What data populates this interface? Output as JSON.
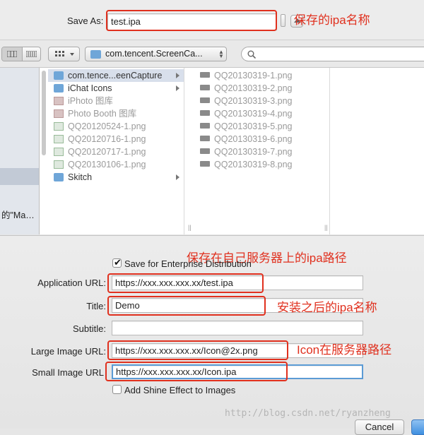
{
  "save_as": {
    "label": "Save As:",
    "value": "test.ipa"
  },
  "annotations": {
    "ipa_name": "保存的ipa名称",
    "server_path": "保存在自己服务器上的ipa路径",
    "post_install_name": "安装之后的ipa名称",
    "icon_path": "Icon在服务器路径"
  },
  "toolbar": {
    "location": "com.tencent.ScreenCa..."
  },
  "sidebar": {
    "truncated_text": "的\"Ma…"
  },
  "column1": [
    {
      "name": "com.tence...eenCapture",
      "icon": "folder-icon",
      "selected": true,
      "has_child": true,
      "dim": false
    },
    {
      "name": "iChat Icons",
      "icon": "folder-icon",
      "selected": false,
      "has_child": true,
      "dim": false
    },
    {
      "name": "iPhoto 图库",
      "icon": "photo-library-icon",
      "selected": false,
      "has_child": false,
      "dim": true
    },
    {
      "name": "Photo Booth 图库",
      "icon": "photo-library-icon",
      "selected": false,
      "has_child": false,
      "dim": true
    },
    {
      "name": "QQ20120524-1.png",
      "icon": "image-file-icon",
      "selected": false,
      "has_child": false,
      "dim": true
    },
    {
      "name": "QQ20120716-1.png",
      "icon": "image-file-icon",
      "selected": false,
      "has_child": false,
      "dim": true
    },
    {
      "name": "QQ20120717-1.png",
      "icon": "image-file-icon",
      "selected": false,
      "has_child": false,
      "dim": true
    },
    {
      "name": "QQ20130106-1.png",
      "icon": "image-file-icon",
      "selected": false,
      "has_child": false,
      "dim": true
    },
    {
      "name": "Skitch",
      "icon": "folder-icon",
      "selected": false,
      "has_child": true,
      "dim": false
    }
  ],
  "column2": [
    "QQ20130319-1.png",
    "QQ20130319-2.png",
    "QQ20130319-3.png",
    "QQ20130319-4.png",
    "QQ20130319-5.png",
    "QQ20130319-6.png",
    "QQ20130319-7.png",
    "QQ20130319-8.png"
  ],
  "options": {
    "save_enterprise": "Save for Enterprise Distribution",
    "save_enterprise_checked": true,
    "app_url_label": "Application URL:",
    "app_url": "https://xxx.xxx.xxx.xx/test.ipa",
    "title_label": "Title:",
    "title": "Demo",
    "subtitle_label": "Subtitle:",
    "subtitle": "",
    "large_image_label": "Large Image URL:",
    "large_image": "https://xxx.xxx.xxx.xx/Icon@2x.png",
    "small_image_label": "Small Image URL",
    "small_image": "https://xxx.xxx.xxx.xx/Icon.ipa",
    "shine_effect": "Add Shine Effect to Images",
    "shine_effect_checked": false
  },
  "footer": {
    "cancel": "Cancel",
    "watermark": "http://blog.csdn.net/ryanzheng"
  },
  "colors": {
    "annotation": "#e0301e",
    "selection": "#d8dfeb",
    "focus": "#5b9bd5"
  }
}
